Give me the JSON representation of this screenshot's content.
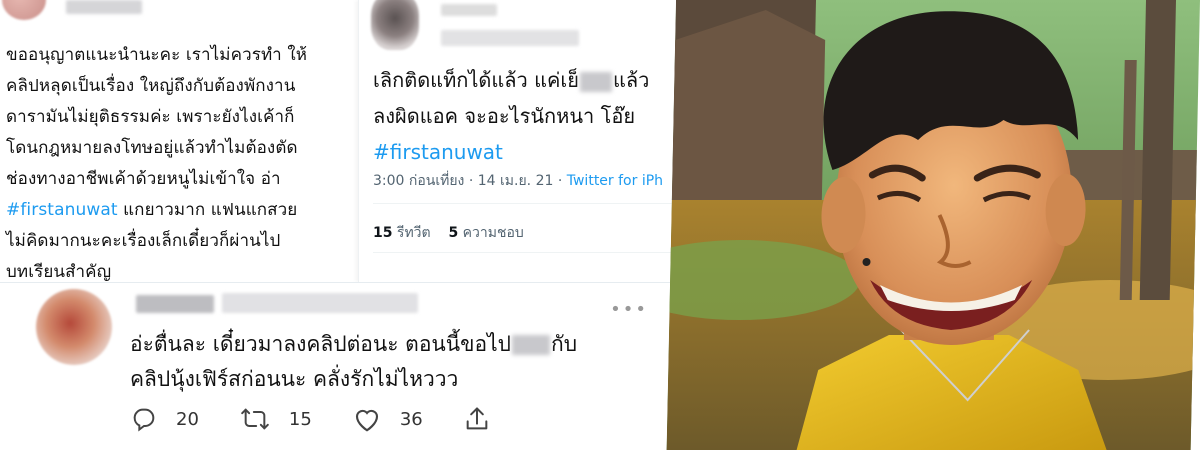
{
  "tweet_left": {
    "lines": [
      "ขออนุญาตแนะนำนะคะ เราไม่ควรทำ ให้",
      "คลิปหลุดเป็นเรื่อง ใหญ่ถึงกับต้องพักงาน",
      "ดารามันไม่ยุติธรรมค่ะ เพราะยังไงเค้าก็",
      "โดนกฎหมายลงโทษอยู่แล้วทำไมต้องตัด",
      "ช่องทางอาชีพเค้าด้วยหนูไม่เข้าใจ อ่า"
    ],
    "hashtag": "#firstanuwat",
    "after_hashtag": " แกยาวมาก แฟนแกสวย",
    "lines_after": [
      "ไม่คิดมากนะคะเรื่องเล็กเดี๋ยวก็ผ่านไป",
      "บทเรียนสำคัญ"
    ]
  },
  "tweet_mid": {
    "line1_a": "เลิกติดแท็กได้แล้ว แค่เย็",
    "line1_b": "แล้ว",
    "line2": "ลงผิดแอค จะอะไรนักหนา โอ๊ย",
    "hashtag": "#firstanuwat",
    "meta_time": "3:00 ก่อนเที่ยง · 14 เม.ย. 21 · ",
    "meta_source": "Twitter for iPh",
    "retweets": "15",
    "retweets_label": " รีทวีต",
    "likes": "5",
    "likes_label": " ความชอบ"
  },
  "tweet_bottom": {
    "line1_a": "อ่ะตื่นละ เดี๋ยวมาลงคลิปต่อนะ ตอนนี้ขอไป",
    "line1_b": "กับ",
    "line2": "คลิปนุ้งเฟิร์สก่อนนะ คลั่งรักไม่ไหววว",
    "more": "•••",
    "replies": "20",
    "retweets": "15",
    "likes": "36"
  },
  "icons": {
    "reply": "reply-icon",
    "retweet": "retweet-icon",
    "like": "heart-icon",
    "share": "share-icon"
  },
  "colors": {
    "link": "#1d9bf0",
    "text": "#111111",
    "muted": "#536471",
    "shirt": "#e5b81f"
  }
}
